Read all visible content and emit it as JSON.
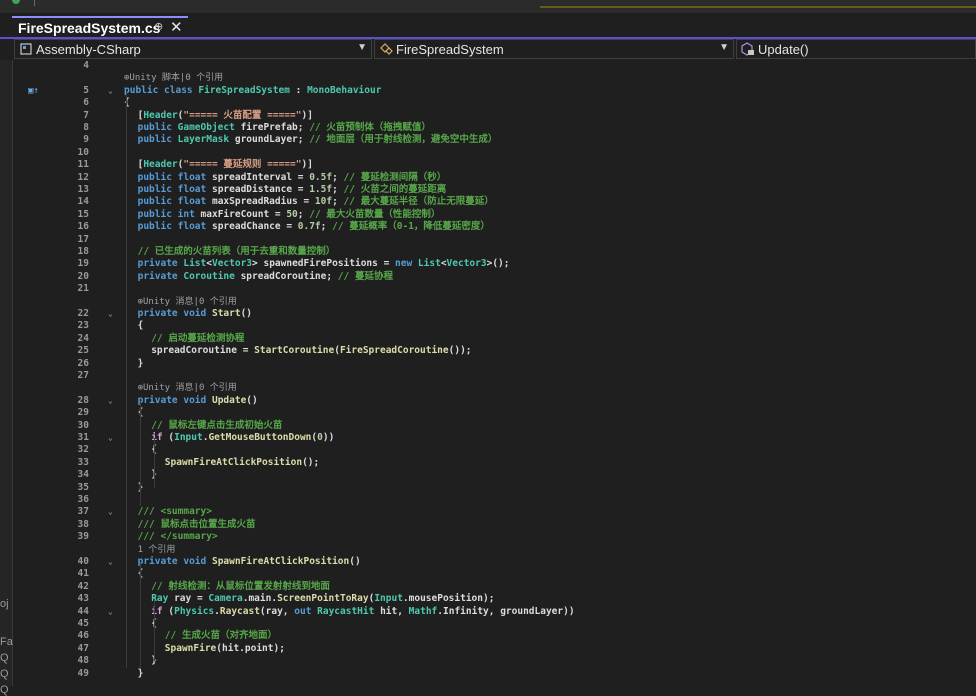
{
  "tab": {
    "title": "FireSpreadSystem.cs",
    "pin": "⊕",
    "close": "✕"
  },
  "nav": {
    "project": "Assembly-CSharp",
    "type": "FireSpreadSystem",
    "member": "Update()"
  },
  "colors": {
    "keyword": "#569cd6",
    "type": "#4ec9b0",
    "comment": "#57a64a",
    "string": "#d69d85",
    "method": "#dcdcaa",
    "control": "#d8a0df",
    "number": "#b5cea8",
    "text": "#dcdcdc"
  },
  "left_fragments": [
    "oj",
    "Fa",
    "Q",
    "Q",
    "Q"
  ],
  "lines": [
    {
      "n": "4",
      "s": []
    },
    {
      "n": "",
      "hint": "⊕Unity 脚本|0 个引用",
      "indent": 1
    },
    {
      "n": "5",
      "gutter": "▣↑",
      "fold": "⌄",
      "indent": 1,
      "s": [
        [
          "kw",
          "public "
        ],
        [
          "kw",
          "class "
        ],
        [
          "tp",
          "FireSpreadSystem"
        ],
        [
          "id",
          " : "
        ],
        [
          "tp",
          "MonoBehaviour"
        ]
      ]
    },
    {
      "n": "6",
      "indent": 1,
      "s": [
        [
          "id",
          "{"
        ]
      ]
    },
    {
      "n": "7",
      "indent": 2,
      "s": [
        [
          "id",
          "["
        ],
        [
          "at",
          "Header"
        ],
        [
          "id",
          "("
        ],
        [
          "st",
          "\"===== 火苗配置 =====\""
        ],
        [
          "id",
          ")]"
        ]
      ]
    },
    {
      "n": "8",
      "indent": 2,
      "s": [
        [
          "kw",
          "public "
        ],
        [
          "tp",
          "GameObject"
        ],
        [
          "id",
          " firePrefab; "
        ],
        [
          "cm",
          "// 火苗预制体（拖拽赋值）"
        ]
      ]
    },
    {
      "n": "9",
      "indent": 2,
      "s": [
        [
          "kw",
          "public "
        ],
        [
          "tp",
          "LayerMask"
        ],
        [
          "id",
          " groundLayer; "
        ],
        [
          "cm",
          "// 地面层（用于射线检测，避免空中生成）"
        ]
      ]
    },
    {
      "n": "10",
      "s": []
    },
    {
      "n": "11",
      "indent": 2,
      "s": [
        [
          "id",
          "["
        ],
        [
          "at",
          "Header"
        ],
        [
          "id",
          "("
        ],
        [
          "st",
          "\"===== 蔓延规则 =====\""
        ],
        [
          "id",
          ")]"
        ]
      ]
    },
    {
      "n": "12",
      "indent": 2,
      "s": [
        [
          "kw",
          "public "
        ],
        [
          "kw",
          "float"
        ],
        [
          "id",
          " spreadInterval = "
        ],
        [
          "num",
          "0.5f"
        ],
        [
          "id",
          "; "
        ],
        [
          "cm",
          "// 蔓延检测间隔（秒）"
        ]
      ]
    },
    {
      "n": "13",
      "indent": 2,
      "s": [
        [
          "kw",
          "public "
        ],
        [
          "kw",
          "float"
        ],
        [
          "id",
          " spreadDistance = "
        ],
        [
          "num",
          "1.5f"
        ],
        [
          "id",
          "; "
        ],
        [
          "cm",
          "// 火苗之间的蔓延距离"
        ]
      ]
    },
    {
      "n": "14",
      "indent": 2,
      "s": [
        [
          "kw",
          "public "
        ],
        [
          "kw",
          "float"
        ],
        [
          "id",
          " maxSpreadRadius = "
        ],
        [
          "num",
          "10f"
        ],
        [
          "id",
          "; "
        ],
        [
          "cm",
          "// 最大蔓延半径（防止无限蔓延）"
        ]
      ]
    },
    {
      "n": "15",
      "indent": 2,
      "s": [
        [
          "kw",
          "public "
        ],
        [
          "kw",
          "int"
        ],
        [
          "id",
          " maxFireCount = "
        ],
        [
          "num",
          "50"
        ],
        [
          "id",
          "; "
        ],
        [
          "cm",
          "// 最大火苗数量（性能控制）"
        ]
      ]
    },
    {
      "n": "16",
      "indent": 2,
      "s": [
        [
          "kw",
          "public "
        ],
        [
          "kw",
          "float"
        ],
        [
          "id",
          " spreadChance = "
        ],
        [
          "num",
          "0.7f"
        ],
        [
          "id",
          "; "
        ],
        [
          "cm",
          "// 蔓延概率（0-1，降低蔓延密度）"
        ]
      ]
    },
    {
      "n": "17",
      "s": []
    },
    {
      "n": "18",
      "indent": 2,
      "s": [
        [
          "cm",
          "// 已生成的火苗列表（用于去重和数量控制）"
        ]
      ]
    },
    {
      "n": "19",
      "indent": 2,
      "s": [
        [
          "kw",
          "private "
        ],
        [
          "tp",
          "List"
        ],
        [
          "id",
          "<"
        ],
        [
          "tp",
          "Vector3"
        ],
        [
          "id",
          "> spawnedFirePositions = "
        ],
        [
          "kw",
          "new "
        ],
        [
          "tp",
          "List"
        ],
        [
          "id",
          "<"
        ],
        [
          "tp",
          "Vector3"
        ],
        [
          "id",
          ">();"
        ]
      ]
    },
    {
      "n": "20",
      "indent": 2,
      "s": [
        [
          "kw",
          "private "
        ],
        [
          "tp",
          "Coroutine"
        ],
        [
          "id",
          " spreadCoroutine; "
        ],
        [
          "cm",
          "// 蔓延协程"
        ]
      ]
    },
    {
      "n": "21",
      "s": []
    },
    {
      "n": "",
      "hint": "⊕Unity 消息|0 个引用",
      "indent": 2
    },
    {
      "n": "22",
      "fold": "⌄",
      "indent": 2,
      "s": [
        [
          "kw",
          "private "
        ],
        [
          "kw",
          "void "
        ],
        [
          "mt",
          "Start"
        ],
        [
          "id",
          "()"
        ]
      ]
    },
    {
      "n": "23",
      "indent": 2,
      "s": [
        [
          "id",
          "{"
        ]
      ]
    },
    {
      "n": "24",
      "indent": 3,
      "s": [
        [
          "cm",
          "// 启动蔓延检测协程"
        ]
      ]
    },
    {
      "n": "25",
      "indent": 3,
      "s": [
        [
          "id",
          "spreadCoroutine = "
        ],
        [
          "mt",
          "StartCoroutine"
        ],
        [
          "id",
          "("
        ],
        [
          "mt",
          "FireSpreadCoroutine"
        ],
        [
          "id",
          "());"
        ]
      ]
    },
    {
      "n": "26",
      "indent": 2,
      "s": [
        [
          "id",
          "}"
        ]
      ]
    },
    {
      "n": "27",
      "s": []
    },
    {
      "n": "",
      "hint": "⊕Unity 消息|0 个引用",
      "indent": 2
    },
    {
      "n": "28",
      "fold": "⌄",
      "indent": 2,
      "s": [
        [
          "kw",
          "private "
        ],
        [
          "kw",
          "void "
        ],
        [
          "mt",
          "Update"
        ],
        [
          "id",
          "()"
        ]
      ]
    },
    {
      "n": "29",
      "indent": 2,
      "s": [
        [
          "id",
          "{"
        ]
      ]
    },
    {
      "n": "30",
      "indent": 3,
      "s": [
        [
          "cm",
          "// 鼠标左键点击生成初始火苗"
        ]
      ]
    },
    {
      "n": "31",
      "fold": "⌄",
      "indent": 3,
      "s": [
        [
          "ctl",
          "if "
        ],
        [
          "id",
          "("
        ],
        [
          "tp",
          "Input"
        ],
        [
          "id",
          "."
        ],
        [
          "mt",
          "GetMouseButtonDown"
        ],
        [
          "id",
          "("
        ],
        [
          "num",
          "0"
        ],
        [
          "id",
          "))"
        ]
      ]
    },
    {
      "n": "32",
      "indent": 3,
      "s": [
        [
          "id",
          "{"
        ]
      ]
    },
    {
      "n": "33",
      "indent": 4,
      "s": [
        [
          "mt",
          "SpawnFireAtClickPosition"
        ],
        [
          "id",
          "();"
        ]
      ]
    },
    {
      "n": "34",
      "indent": 3,
      "s": [
        [
          "id",
          "}"
        ]
      ]
    },
    {
      "n": "35",
      "indent": 2,
      "s": [
        [
          "id",
          "}"
        ]
      ]
    },
    {
      "n": "36",
      "s": []
    },
    {
      "n": "37",
      "fold": "⌄",
      "indent": 2,
      "s": [
        [
          "cm",
          "/// <summary>"
        ]
      ]
    },
    {
      "n": "38",
      "indent": 2,
      "s": [
        [
          "cm",
          "/// 鼠标点击位置生成火苗"
        ]
      ]
    },
    {
      "n": "39",
      "indent": 2,
      "s": [
        [
          "cm",
          "/// </summary>"
        ]
      ]
    },
    {
      "n": "",
      "hint": "1 个引用",
      "indent": 2
    },
    {
      "n": "40",
      "fold": "⌄",
      "indent": 2,
      "s": [
        [
          "kw",
          "private "
        ],
        [
          "kw",
          "void "
        ],
        [
          "mt",
          "SpawnFireAtClickPosition"
        ],
        [
          "id",
          "()"
        ]
      ]
    },
    {
      "n": "41",
      "indent": 2,
      "s": [
        [
          "id",
          "{"
        ]
      ]
    },
    {
      "n": "42",
      "indent": 3,
      "s": [
        [
          "cm",
          "// 射线检测：从鼠标位置发射射线到地面"
        ]
      ]
    },
    {
      "n": "43",
      "indent": 3,
      "s": [
        [
          "tp",
          "Ray"
        ],
        [
          "id",
          " ray = "
        ],
        [
          "tp",
          "Camera"
        ],
        [
          "id",
          ".main."
        ],
        [
          "mt",
          "ScreenPointToRay"
        ],
        [
          "id",
          "("
        ],
        [
          "tp",
          "Input"
        ],
        [
          "id",
          ".mousePosition);"
        ]
      ]
    },
    {
      "n": "44",
      "fold": "⌄",
      "indent": 3,
      "s": [
        [
          "ctl",
          "if "
        ],
        [
          "id",
          "("
        ],
        [
          "tp",
          "Physics"
        ],
        [
          "id",
          "."
        ],
        [
          "mt",
          "Raycast"
        ],
        [
          "id",
          "(ray, "
        ],
        [
          "kw",
          "out "
        ],
        [
          "tp",
          "RaycastHit"
        ],
        [
          "id",
          " hit, "
        ],
        [
          "tp",
          "Mathf"
        ],
        [
          "id",
          ".Infinity, groundLayer))"
        ]
      ]
    },
    {
      "n": "45",
      "indent": 3,
      "s": [
        [
          "id",
          "{"
        ]
      ]
    },
    {
      "n": "46",
      "indent": 4,
      "s": [
        [
          "cm",
          "// 生成火苗（对齐地面）"
        ]
      ]
    },
    {
      "n": "47",
      "indent": 4,
      "s": [
        [
          "mt",
          "SpawnFire"
        ],
        [
          "id",
          "(hit.point);"
        ]
      ]
    },
    {
      "n": "48",
      "indent": 3,
      "s": [
        [
          "id",
          "}"
        ]
      ]
    },
    {
      "n": "49",
      "indent": 2,
      "s": [
        [
          "id",
          "}"
        ]
      ]
    }
  ]
}
